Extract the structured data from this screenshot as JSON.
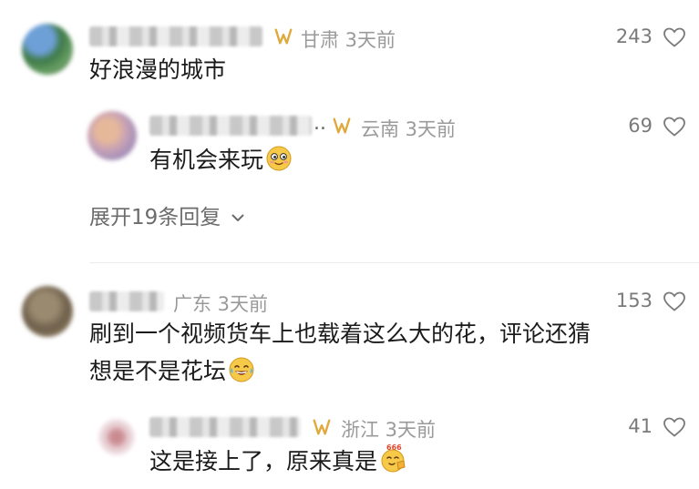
{
  "comments": [
    {
      "region": "甘肃 3天前",
      "likes": "243",
      "text": "好浪漫的城市",
      "reply": {
        "name_suffix": "..",
        "region": "云南 3天前",
        "likes": "69",
        "text": "有机会来玩"
      },
      "expand_label": "展开19条回复"
    },
    {
      "region": "广东 3天前",
      "likes": "153",
      "text_line1": "刷到一个视频货车上也载着这么大的花，评论还猜",
      "text_line2": "想是不是花坛",
      "reply": {
        "region": "浙江 3天前",
        "likes": "41",
        "text": "这是接上了，原来真是"
      }
    }
  ],
  "icons": {
    "heart": "heart-outline-icon",
    "badge": "gold-fan-badge-icon",
    "emoji_1": "smile-emoji-icon",
    "emoji_2": "laugh-cry-emoji-icon",
    "emoji_3": "666-thumbs-emoji-icon",
    "chevron": "chevron-down-icon"
  },
  "colors": {
    "badge": "#e0a93b",
    "meta": "#9a9a9a",
    "text": "#1b1b1b"
  }
}
